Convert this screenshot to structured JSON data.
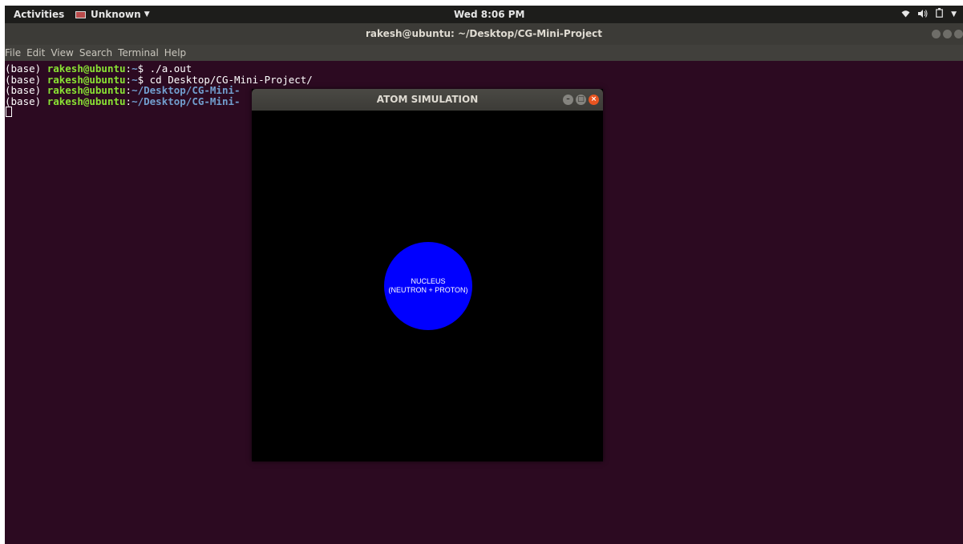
{
  "top_panel": {
    "activities": "Activities",
    "app_name": "Unknown",
    "clock": "Wed  8:06 PM"
  },
  "terminal": {
    "title": "rakesh@ubuntu: ~/Desktop/CG-Mini-Project",
    "menu": [
      "File",
      "Edit",
      "View",
      "Search",
      "Terminal",
      "Help"
    ],
    "lines": [
      {
        "env": "(base) ",
        "user": "rakesh@ubuntu",
        "sep": ":",
        "path": "~",
        "cmd": "$ ./a.out"
      },
      {
        "env": "(base) ",
        "user": "rakesh@ubuntu",
        "sep": ":",
        "path": "~",
        "cmd": "$ cd Desktop/CG-Mini-Project/"
      },
      {
        "env": "(base) ",
        "user": "rakesh@ubuntu",
        "sep": ":",
        "path": "~/Desktop/CG-Mini-",
        "cmd": ""
      },
      {
        "env": "(base) ",
        "user": "rakesh@ubuntu",
        "sep": ":",
        "path": "~/Desktop/CG-Mini-",
        "cmd": ""
      }
    ]
  },
  "atom_window": {
    "title": "ATOM SIMULATION",
    "nucleus_line1": "NUCLEUS",
    "nucleus_line2": "(NEUTRON + PROTON)",
    "nucleus_color": "#0000ff"
  },
  "colors": {
    "desktop_bg": "#2c0a21",
    "close_button": "#e95420",
    "prompt_user": "#8ae234",
    "prompt_path": "#729fcf"
  }
}
